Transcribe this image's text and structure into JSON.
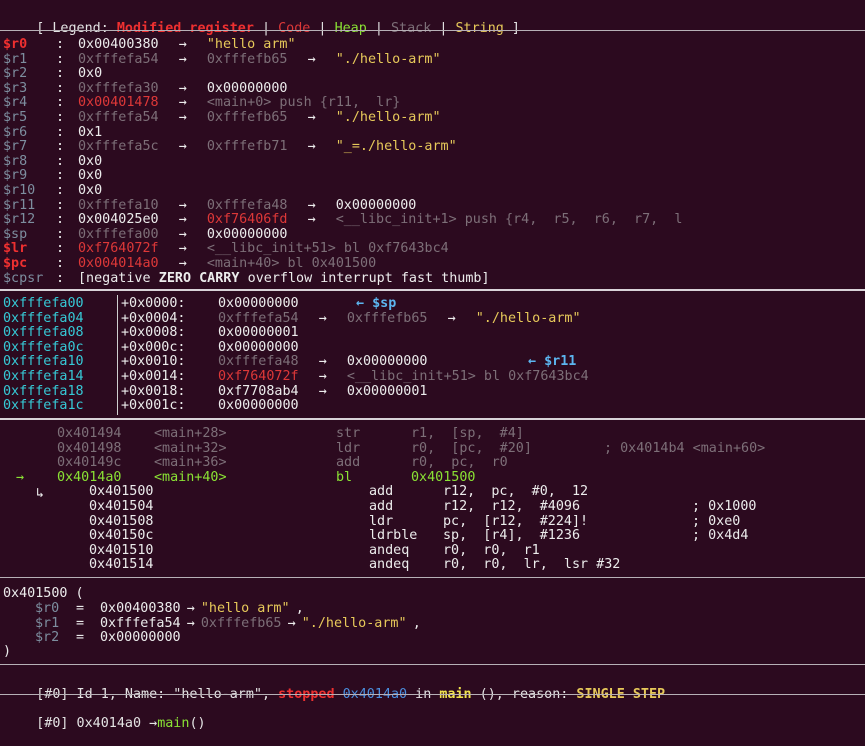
{
  "legend": {
    "open": "[ Legend: ",
    "modified": "Modified register",
    "pipe": " | ",
    "code": "Code",
    "heap": "Heap",
    "stack": "Stack",
    "string": "String",
    "close": " ]"
  },
  "colors": {
    "background": "#2c0a1f",
    "modified": "#ef3030",
    "code": "#dd3838",
    "heap": "#8ae234",
    "stack": "#7d6f78",
    "string": "#e7c95a",
    "stack_address": "#36c9d6",
    "arrow_marker": "#5cb6f0"
  },
  "registers": [
    {
      "name": "$r0",
      "modified": true,
      "value": "0x00400380",
      "chain": [
        {
          "t": "→",
          "c": "white"
        },
        {
          "t": "\"hello arm\"",
          "c": "yellow"
        }
      ]
    },
    {
      "name": "$r1",
      "modified": false,
      "value": "0xfffefa54",
      "value_color": "grey",
      "chain": [
        {
          "t": "→",
          "c": "white"
        },
        {
          "t": "0xfffefb65",
          "c": "grey"
        },
        {
          "t": "→",
          "c": "white"
        },
        {
          "t": "\"./hello-arm\"",
          "c": "yellow"
        }
      ]
    },
    {
      "name": "$r2",
      "modified": false,
      "value": "0x0",
      "chain": []
    },
    {
      "name": "$r3",
      "modified": false,
      "value": "0xfffefa30",
      "value_color": "grey",
      "chain": [
        {
          "t": "→",
          "c": "white"
        },
        {
          "t": "0x00000000",
          "c": "white"
        }
      ]
    },
    {
      "name": "$r4",
      "modified": false,
      "value": "0x00401478",
      "value_color": "codered",
      "chain": [
        {
          "t": "→",
          "c": "white"
        },
        {
          "t": "<main+0> push {r11,  lr}",
          "c": "grey"
        }
      ]
    },
    {
      "name": "$r5",
      "modified": false,
      "value": "0xfffefa54",
      "value_color": "grey",
      "chain": [
        {
          "t": "→",
          "c": "white"
        },
        {
          "t": "0xfffefb65",
          "c": "grey"
        },
        {
          "t": "→",
          "c": "white"
        },
        {
          "t": "\"./hello-arm\"",
          "c": "yellow"
        }
      ]
    },
    {
      "name": "$r6",
      "modified": false,
      "value": "0x1",
      "chain": []
    },
    {
      "name": "$r7",
      "modified": false,
      "value": "0xfffefa5c",
      "value_color": "grey",
      "chain": [
        {
          "t": "→",
          "c": "white"
        },
        {
          "t": "0xfffefb71",
          "c": "grey"
        },
        {
          "t": "→",
          "c": "white"
        },
        {
          "t": "\"_=./hello-arm\"",
          "c": "yellow"
        }
      ]
    },
    {
      "name": "$r8",
      "modified": false,
      "value": "0x0",
      "chain": []
    },
    {
      "name": "$r9",
      "modified": false,
      "value": "0x0",
      "chain": []
    },
    {
      "name": "$r10",
      "modified": false,
      "value": "0x0",
      "chain": []
    },
    {
      "name": "$r11",
      "modified": false,
      "value": "0xfffefa10",
      "value_color": "grey",
      "chain": [
        {
          "t": "→",
          "c": "white"
        },
        {
          "t": "0xfffefa48",
          "c": "grey"
        },
        {
          "t": "→",
          "c": "white"
        },
        {
          "t": "0x00000000",
          "c": "white"
        }
      ]
    },
    {
      "name": "$r12",
      "modified": false,
      "value": "0x004025e0",
      "chain": [
        {
          "t": "→",
          "c": "white"
        },
        {
          "t": "0xf76406fd",
          "c": "codered"
        },
        {
          "t": "→",
          "c": "white"
        },
        {
          "t": "<__libc_init+1> push {r4,  r5,  r6,  r7,  l",
          "c": "grey"
        }
      ]
    },
    {
      "name": "$sp",
      "modified": false,
      "value": "0xfffefa00",
      "value_color": "grey",
      "chain": [
        {
          "t": "→",
          "c": "white"
        },
        {
          "t": "0x00000000",
          "c": "white"
        }
      ]
    },
    {
      "name": "$lr",
      "modified": true,
      "value": "0xf764072f",
      "value_color": "codered",
      "chain": [
        {
          "t": "→",
          "c": "white"
        },
        {
          "t": "<__libc_init+51> bl 0xf7643bc4",
          "c": "grey"
        }
      ]
    },
    {
      "name": "$pc",
      "modified": true,
      "value": "0x004014a0",
      "value_color": "codered",
      "chain": [
        {
          "t": "→",
          "c": "white"
        },
        {
          "t": "<main+40> bl 0x401500",
          "c": "grey"
        }
      ]
    },
    {
      "name": "$cpsr",
      "modified": false,
      "value": "[negative ",
      "chain": [
        {
          "t": "ZERO CARRY",
          "c": "bold"
        },
        {
          "t": " overflow interrupt fast thumb]",
          "c": "white"
        }
      ]
    }
  ],
  "stack": [
    {
      "addr": "0xfffefa00",
      "offset": "+0x0000:",
      "value": "0x00000000",
      "value_color": "white",
      "chain": [],
      "marker": "← $sp"
    },
    {
      "addr": "0xfffefa04",
      "offset": "+0x0004:",
      "value": "0xfffefa54",
      "value_color": "grey",
      "chain": [
        {
          "t": "→",
          "c": "white"
        },
        {
          "t": "0xfffefb65",
          "c": "grey"
        },
        {
          "t": "→",
          "c": "white"
        },
        {
          "t": "\"./hello-arm\"",
          "c": "yellow"
        }
      ],
      "marker": ""
    },
    {
      "addr": "0xfffefa08",
      "offset": "+0x0008:",
      "value": "0x00000001",
      "value_color": "white",
      "chain": [],
      "marker": ""
    },
    {
      "addr": "0xfffefa0c",
      "offset": "+0x000c:",
      "value": "0x00000000",
      "value_color": "white",
      "chain": [],
      "marker": ""
    },
    {
      "addr": "0xfffefa10",
      "offset": "+0x0010:",
      "value": "0xfffefa48",
      "value_color": "grey",
      "chain": [
        {
          "t": "→",
          "c": "white"
        },
        {
          "t": "0x00000000",
          "c": "white"
        }
      ],
      "marker": "← $r11"
    },
    {
      "addr": "0xfffefa14",
      "offset": "+0x0014:",
      "value": "0xf764072f",
      "value_color": "codered",
      "chain": [
        {
          "t": "→",
          "c": "white"
        },
        {
          "t": "<__libc_init+51> bl 0xf7643bc4",
          "c": "grey"
        }
      ],
      "marker": ""
    },
    {
      "addr": "0xfffefa18",
      "offset": "+0x0018:",
      "value": "0xf7708ab4",
      "value_color": "white",
      "chain": [
        {
          "t": "→",
          "c": "white"
        },
        {
          "t": "0x00000001",
          "c": "white"
        }
      ],
      "marker": ""
    },
    {
      "addr": "0xfffefa1c",
      "offset": "+0x001c:",
      "value": "0x00000000",
      "value_color": "white",
      "chain": [],
      "marker": ""
    }
  ],
  "code": [
    {
      "prefix": "",
      "addr": "0x401494",
      "sym": "<main+28>",
      "mnem": "str",
      "ops": "r1,  [sp,  #4]",
      "comment": "",
      "style": "past"
    },
    {
      "prefix": "",
      "addr": "0x401498",
      "sym": "<main+32>",
      "mnem": "ldr",
      "ops": "r0,  [pc,  #20]",
      "comment": "; 0x4014b4 <main+60>",
      "style": "past"
    },
    {
      "prefix": "",
      "addr": "0x40149c",
      "sym": "<main+36>",
      "mnem": "add",
      "ops": "r0,  pc,  r0",
      "comment": "",
      "style": "past"
    },
    {
      "prefix": "→",
      "addr": "0x4014a0",
      "sym": "<main+40>",
      "mnem": "bl",
      "ops": "0x401500",
      "comment": "",
      "style": "current"
    },
    {
      "prefix": "↳",
      "addr": "0x401500",
      "sym": "",
      "mnem": "add",
      "ops": "r12,  pc,  #0,  12",
      "comment": "",
      "style": "target"
    },
    {
      "prefix": "",
      "addr": "0x401504",
      "sym": "",
      "mnem": "add",
      "ops": "r12,  r12,  #4096",
      "comment": "; 0x1000",
      "style": "target"
    },
    {
      "prefix": "",
      "addr": "0x401508",
      "sym": "",
      "mnem": "ldr",
      "ops": "pc,  [r12,  #224]!",
      "comment": "; 0xe0",
      "style": "target"
    },
    {
      "prefix": "",
      "addr": "0x40150c",
      "sym": "",
      "mnem": "ldrble",
      "ops": "sp,  [r4],  #1236",
      "comment": "; 0x4d4",
      "style": "target"
    },
    {
      "prefix": "",
      "addr": "0x401510",
      "sym": "",
      "mnem": "andeq",
      "ops": "r0,  r0,  r1",
      "comment": "",
      "style": "target"
    },
    {
      "prefix": "",
      "addr": "0x401514",
      "sym": "",
      "mnem": "andeq",
      "ops": "r0,  r0,  lr,  lsr #32",
      "comment": "",
      "style": "target"
    }
  ],
  "call": {
    "head": "0x401500 (",
    "args": [
      {
        "name": "$r0",
        "eq": " = ",
        "value": "0x00400380",
        "chain": [
          {
            "t": "→",
            "c": "white"
          },
          {
            "t": "\"hello arm\"",
            "c": "yellow"
          },
          {
            "t": ",",
            "c": "white"
          }
        ]
      },
      {
        "name": "$r1",
        "eq": " = ",
        "value": "0xfffefa54",
        "chain": [
          {
            "t": "→",
            "c": "white"
          },
          {
            "t": "0xfffefb65",
            "c": "grey"
          },
          {
            "t": "→",
            "c": "white"
          },
          {
            "t": "\"./hello-arm\"",
            "c": "yellow"
          },
          {
            "t": ",",
            "c": "white"
          }
        ]
      },
      {
        "name": "$r2",
        "eq": " = ",
        "value": "0x00000000",
        "chain": []
      }
    ],
    "tail": ")"
  },
  "thread": {
    "tag": "[#0]",
    "text1": " Id 1, Name: \"hello-arm\", ",
    "stopped": "stopped",
    "addr": " 0x4014a0",
    "in": " in ",
    "func": "main",
    "text2": " (), reason: ",
    "reason": "SINGLE STEP"
  },
  "trace": {
    "tag": "[#0]",
    "addr": " 0x4014a0 ",
    "arrow": "→",
    "func": "main",
    "paren": "()"
  }
}
